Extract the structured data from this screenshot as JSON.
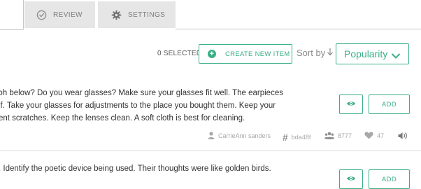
{
  "tabs": {
    "review_label": "REVIEW",
    "settings_label": "SETTINGS"
  },
  "toolbar": {
    "selected_count": "0 SELECTED",
    "create_label": "CREATE NEW ITEM",
    "sort_label": "Sort by",
    "sort_value": "Popularity"
  },
  "items": [
    {
      "lines": [
        "ɔh below?  Do you wear glasses? Make sure your glasses fit well. The earpieces",
        "lf. Take your glasses for adjustments to the place you bought them. Keep your",
        "ent scratches. Keep the lenses clean. A soft cloth is best for cleaning."
      ],
      "add_label": "ADD",
      "author": "CarrieAnn sanders",
      "hash": "bda48f",
      "views": "8777",
      "likes": "47"
    },
    {
      "lines": [
        ". Identify the poetic device being used. Their thoughts were like golden birds."
      ],
      "add_label": "ADD"
    }
  ],
  "colors": {
    "accent": "#3aaf85",
    "tab_bg": "#e6e6e6",
    "muted": "#a8a8a8"
  }
}
